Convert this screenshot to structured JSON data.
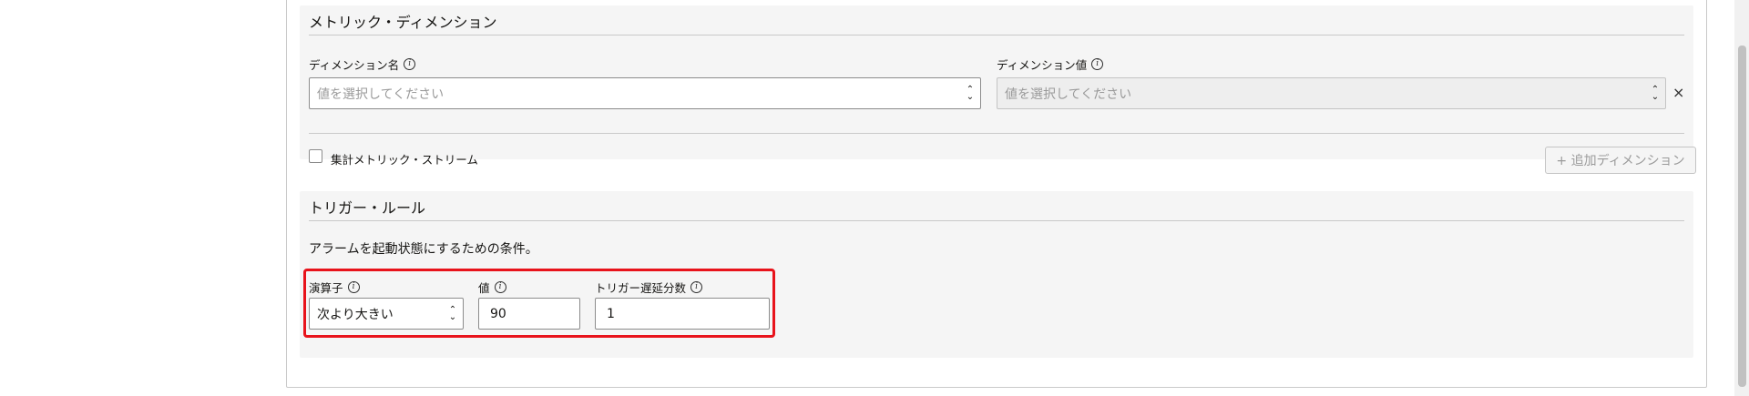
{
  "metric_dimensions": {
    "title": "メトリック・ディメンション",
    "dimension_name": {
      "label": "ディメンション名",
      "placeholder": "値を選択してください"
    },
    "dimension_value": {
      "label": "ディメンション値",
      "placeholder": "値を選択してください"
    },
    "aggregate_checkbox_label": "集計メトリック・ストリーム",
    "add_dimension_button": "+ 追加ディメンション"
  },
  "trigger_rule": {
    "title": "トリガー・ルール",
    "description": "アラームを起動状態にするための条件。",
    "operator": {
      "label": "演算子",
      "value": "次より大きい"
    },
    "value": {
      "label": "値",
      "value": "90"
    },
    "delay": {
      "label": "トリガー遅延分数",
      "value": "1"
    }
  },
  "icons": {
    "info": "i",
    "close": "×",
    "chevron_up": "⌃",
    "chevron_down": "⌄"
  },
  "colors": {
    "highlight": "#e8131b",
    "section_bg": "#f5f5f5"
  }
}
